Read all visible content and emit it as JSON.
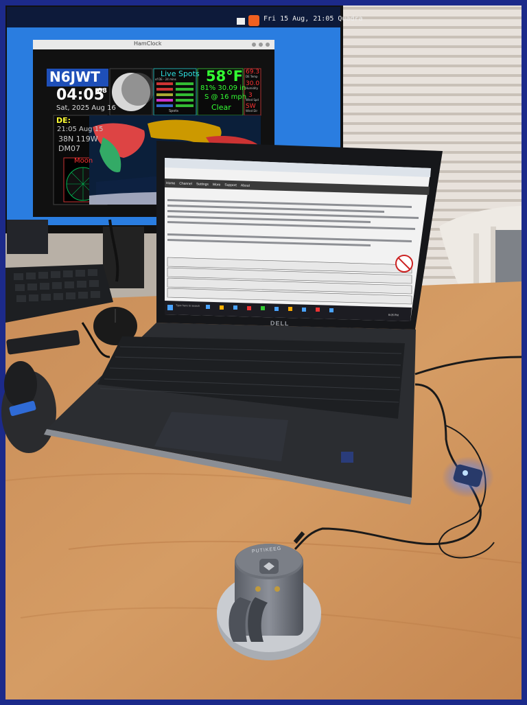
{
  "topbar": {
    "datetime": "Fri 15 Aug, 21:05",
    "network": "Quadra"
  },
  "hamclock": {
    "window_title": "HamClock",
    "callsign": "N6JWT",
    "utc_time": "04:05",
    "utc_seconds": "08",
    "utc_date": "Sat, 2025 Aug 16",
    "live_spots_title": "Live Spots",
    "live_spots_subtitle": "of DE - 24 mins",
    "spots_label": "Spots",
    "temperature": "58°F",
    "humidity_pressure": "81% 30.09 in",
    "wind": "S @ 16 mph",
    "conditions": "Clear",
    "side_values": [
      "69.3",
      "30.0",
      "3",
      "SW"
    ],
    "side_labels": [
      "DE Temp",
      "Humidity",
      "Wind Spd",
      "Wind Dir"
    ],
    "de_label": "DE:",
    "local_time": "21:05 Aug 15",
    "latlong": "38N 119W",
    "grid": "DM07",
    "moon_label": "Moon"
  },
  "laptop": {
    "brand": "DELL",
    "nav_items": [
      "Home",
      "Channel",
      "Settings",
      "More",
      "Support",
      "About"
    ],
    "search_placeholder": "Type here to search",
    "clock": "9:05 PM"
  },
  "device": {
    "brand": "PUTIKEEG"
  }
}
